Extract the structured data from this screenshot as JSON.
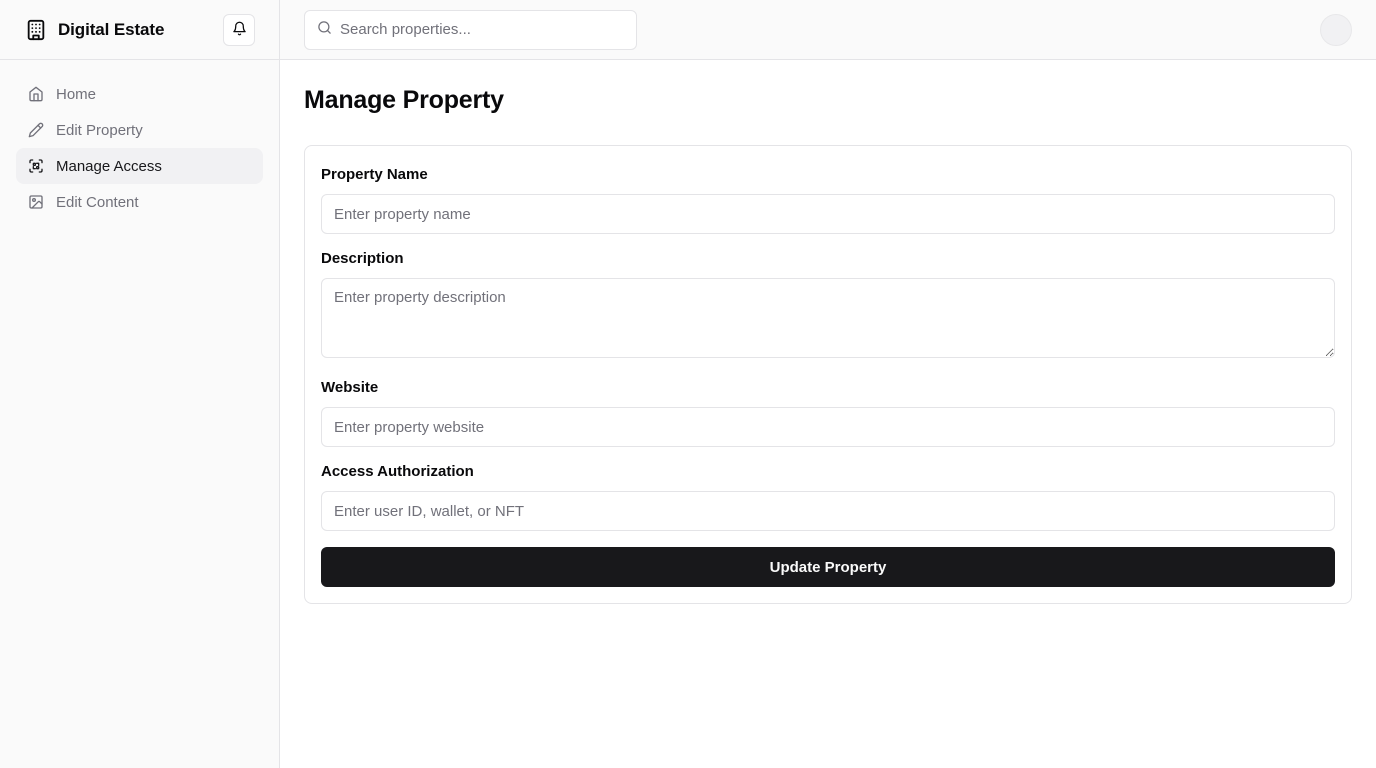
{
  "sidebar": {
    "brand_name": "Digital Estate",
    "brand_icon": "building-icon",
    "notification_icon": "bell-icon",
    "items": [
      {
        "label": "Home",
        "icon": "home-icon",
        "active": false
      },
      {
        "label": "Edit Property",
        "icon": "pencil-icon",
        "active": false
      },
      {
        "label": "Manage Access",
        "icon": "scan-face-icon",
        "active": true
      },
      {
        "label": "Edit Content",
        "icon": "image-icon",
        "active": false
      }
    ]
  },
  "topbar": {
    "search_placeholder": "Search properties...",
    "search_icon": "search-icon"
  },
  "main": {
    "page_title": "Manage Property",
    "form": {
      "property_name": {
        "label": "Property Name",
        "placeholder": "Enter property name",
        "value": ""
      },
      "description": {
        "label": "Description",
        "placeholder": "Enter property description",
        "value": ""
      },
      "website": {
        "label": "Website",
        "placeholder": "Enter property website",
        "value": ""
      },
      "access": {
        "label": "Access Authorization",
        "placeholder": "Enter user ID, wallet, or NFT",
        "value": ""
      },
      "submit_label": "Update Property"
    }
  },
  "colors": {
    "primary": "#18181b",
    "muted_text": "#71717a",
    "border": "#e4e4e7",
    "sidebar_bg": "#fafafa",
    "active_item_bg": "#f1f1f3"
  }
}
